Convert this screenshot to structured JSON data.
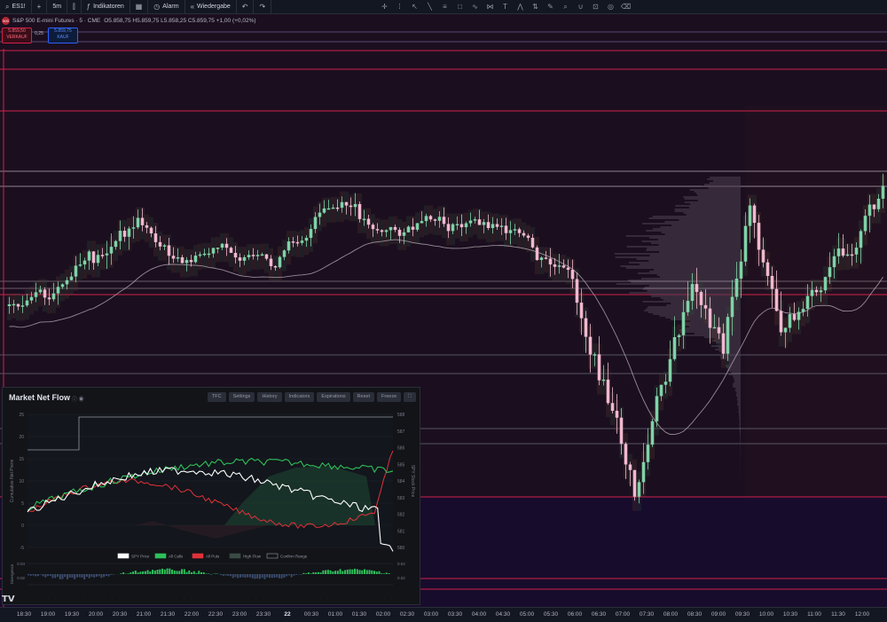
{
  "toolbar": {
    "symbol": "ES1!",
    "add_symbol": "+",
    "interval": "5m",
    "indicators": "Indikatoren",
    "alert": "Alarm",
    "replay": "Wiedergabe"
  },
  "symbol_info": {
    "name": "S&P 500 E-mini Futures · 5 · CME",
    "badge": "500",
    "ohlc": "O5.858,75  H5.859,75  L5.858,25  C5.859,75  +1,00 (+0,02%)"
  },
  "order_boxes": {
    "sell_price": "5.859,50",
    "sell_label": "VERKAUF",
    "spread": "0,25",
    "buy_price": "5.859,75",
    "buy_label": "KAUF"
  },
  "time_axis": [
    "18:30",
    "19:00",
    "19:30",
    "20:00",
    "20:30",
    "21:00",
    "21:30",
    "22:00",
    "22:30",
    "23:00",
    "23:30",
    "22",
    "00:30",
    "01:00",
    "01:30",
    "02:00",
    "02:30",
    "03:00",
    "03:30",
    "04:00",
    "04:30",
    "05:00",
    "05:30",
    "06:00",
    "06:30",
    "07:00",
    "07:30",
    "08:00",
    "08:30",
    "09:00",
    "09:30",
    "10:00",
    "10:30",
    "11:00",
    "11:30",
    "12:00"
  ],
  "panel": {
    "title": "Market Net Flow",
    "buttons": [
      "TFC",
      "Settings",
      "History",
      "Indicators",
      "Expirations",
      "Reset",
      "Freeze"
    ],
    "left_axis_label": "Cumulative Net Premi",
    "right_axis_label": "SPY Stock Price",
    "left_ticks": [
      "25",
      "20",
      "15",
      "10",
      "5",
      "0",
      "-5"
    ],
    "right_ticks": [
      "588",
      "587",
      "586",
      "585",
      "584",
      "583",
      "582",
      "581",
      "580"
    ],
    "legend": [
      "SPY Price",
      "All Calls",
      "All Puts",
      "High Flow",
      "Confirm Range"
    ],
    "lower_label": "Divergence",
    "lower_ticks": [
      "0.04",
      "0.02"
    ],
    "lower_right_ticks": [
      "0.04",
      "0.02"
    ]
  },
  "colors": {
    "bg": "#1b0f1f",
    "bull": "#7fd3a8",
    "bear": "#f2b8d0",
    "red_line": "#d0204a",
    "calls": "#2fbf5a",
    "puts": "#e0323a",
    "price_line": "#ffffff"
  },
  "tv_logo": "TV"
}
